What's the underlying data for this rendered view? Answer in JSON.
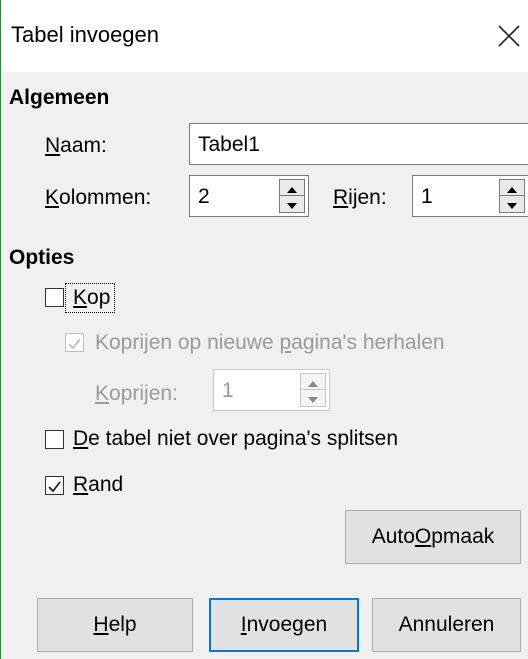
{
  "dialog": {
    "title": "Tabel invoegen",
    "close_icon": "close-icon"
  },
  "general": {
    "heading": "Algemeen",
    "name": {
      "label_accel": "N",
      "label_rest": "aam:",
      "value": "Tabel1"
    },
    "columns": {
      "label_accel": "K",
      "label_rest": "olommen:",
      "value": "2"
    },
    "rows": {
      "label_accel": "R",
      "label_rest": "ijen:",
      "value": "1"
    }
  },
  "options": {
    "heading": "Opties",
    "heading_cb": {
      "label_accel": "K",
      "label_rest": "op",
      "checked": false
    },
    "repeat_heading": {
      "label_pre": "Koprijen op nieuwe ",
      "label_accel": "p",
      "label_post": "agina's herhalen",
      "checked": true,
      "enabled": false
    },
    "heading_rows": {
      "label_accel": "K",
      "label_rest": "oprijen:",
      "value": "1",
      "enabled": false
    },
    "dont_split": {
      "label_accel": "D",
      "label_rest": "e tabel niet over pagina's splitsen",
      "checked": false
    },
    "border": {
      "label_accel": "R",
      "label_rest": "and",
      "checked": true
    }
  },
  "buttons": {
    "autoformat": {
      "pre": "Auto",
      "accel": "O",
      "post": "pmaak"
    },
    "help": {
      "accel": "H",
      "rest": "elp"
    },
    "insert": {
      "accel": "I",
      "rest": "nvoegen"
    },
    "cancel": "Annuleren"
  }
}
